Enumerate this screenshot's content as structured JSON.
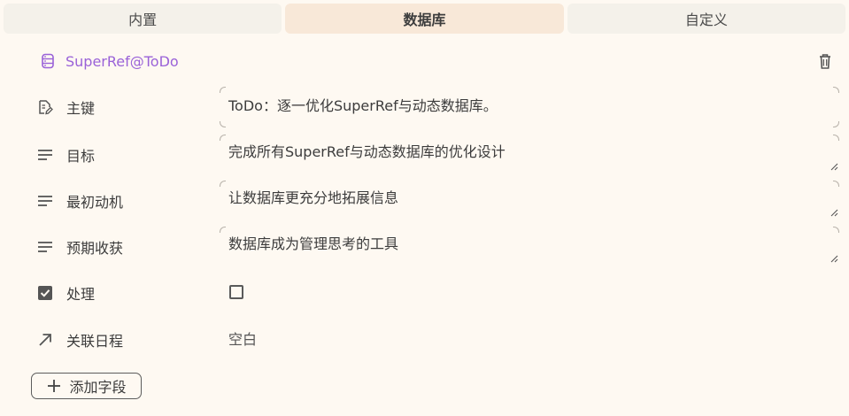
{
  "tabs": [
    {
      "label": "内置",
      "active": false
    },
    {
      "label": "数据库",
      "active": true
    },
    {
      "label": "自定义",
      "active": false
    }
  ],
  "database": {
    "name": "SuperRef@ToDo",
    "icon": "database-icon",
    "accent_color": "#9a62d8",
    "delete_icon": "trash-icon"
  },
  "fields": {
    "primary_key": {
      "label": "主键",
      "icon": "document-edit-icon",
      "value": "ToDo：逐一优化SuperRef与动态数据库。"
    },
    "goal": {
      "label": "目标",
      "icon": "text-lines-icon",
      "value": "完成所有SuperRef与动态数据库的优化设计"
    },
    "motivation": {
      "label": "最初动机",
      "icon": "text-lines-icon",
      "value": "让数据库更充分地拓展信息"
    },
    "expected_gain": {
      "label": "预期收获",
      "icon": "text-lines-icon",
      "value": "数据库成为管理思考的工具"
    },
    "process": {
      "label": "处理",
      "icon": "checkbox-icon",
      "checked": false
    },
    "related_schedule": {
      "label": "关联日程",
      "icon": "arrow-up-right-icon",
      "value": "空白"
    }
  },
  "add_field": {
    "label": "添加字段",
    "icon": "plus-icon"
  }
}
